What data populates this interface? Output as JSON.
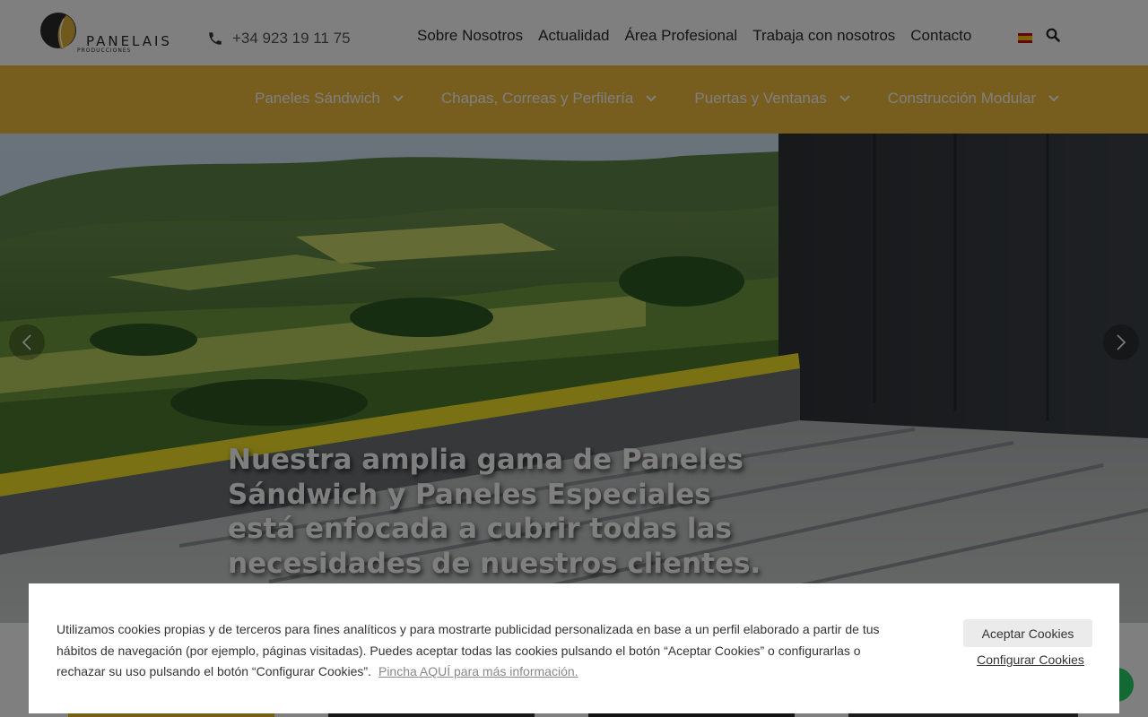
{
  "header": {
    "logo_text": "PANELAIS",
    "logo_subtext": "PRODUCCIONES",
    "phone": "+34 923 19 11 75",
    "nav": [
      "Sobre Nosotros",
      "Actualidad",
      "Área Profesional",
      "Trabaja con nosotros",
      "Contacto"
    ],
    "language_flag": "es-flag-icon",
    "search_icon": "search-icon"
  },
  "product_nav": {
    "items": [
      "Paneles Sándwich",
      "Chapas, Correas y Perfilería",
      "Puertas y Ventanas",
      "Construcción Modular"
    ],
    "background_color": "#f1bc3d"
  },
  "hero": {
    "headline": "Nuestra amplia gama de Paneles Sándwich y Paneles Especiales está enfocada a cubrir todas las necesidades de nuestros clientes.",
    "prev_icon": "chevron-left-icon",
    "next_icon": "chevron-right-icon"
  },
  "cookie_banner": {
    "text": "Utilizamos cookies propias y de terceros para fines analíticos y para mostrarte publicidad personalizada en base a un perfil elaborado a partir de tus hábitos de navegación (por ejemplo, páginas visitadas). Puedes aceptar todas las cookies pulsando el botón “Aceptar Cookies” o configurarlas o rechazar su uso pulsando el botón “Configurar Cookies”.",
    "more_link": "Pincha AQUÍ para más información.",
    "accept_label": "Aceptar Cookies",
    "configure_label": "Configurar Cookies"
  },
  "colors": {
    "brand_gold": "#f1bc3d",
    "whatsapp_green": "#25d366"
  }
}
